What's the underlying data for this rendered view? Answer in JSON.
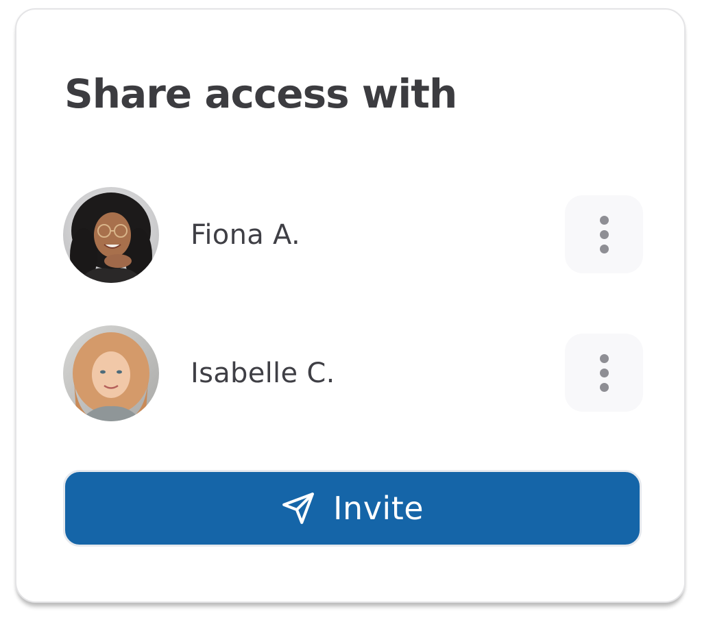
{
  "panel": {
    "title": "Share access with"
  },
  "users": [
    {
      "name": "Fiona A.",
      "avatar_icon": "avatar-photo",
      "menu_icon": "more-vertical-icon"
    },
    {
      "name": "Isabelle C.",
      "avatar_icon": "avatar-photo",
      "menu_icon": "more-vertical-icon"
    }
  ],
  "invite": {
    "label": "Invite",
    "icon": "send-icon",
    "color": "#1565a8"
  },
  "colors": {
    "title": "#3c3c40",
    "text": "#3f3f45",
    "menu_button_bg": "#f8f8fa",
    "menu_dots": "#8e8e94"
  }
}
